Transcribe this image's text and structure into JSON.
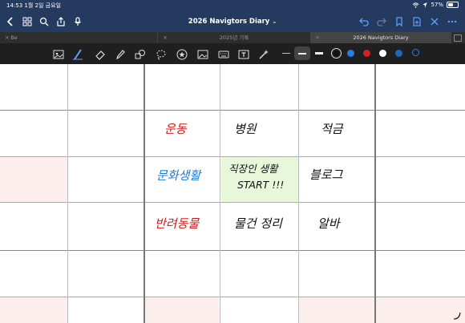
{
  "status_bar": {
    "time": "14:53",
    "date": "1월 2일 금요일",
    "battery": "57%",
    "battery_level": 0.57
  },
  "header": {
    "title": "2026 Navigtors Diary"
  },
  "tabs": [
    {
      "label": "Be",
      "active": false
    },
    {
      "label": "2025년 기록",
      "active": false
    },
    {
      "label": "2026 Navigtors Diary",
      "active": true
    }
  ],
  "toolbar": {
    "tools": [
      "image-icon",
      "pen-icon",
      "eraser-icon",
      "highlighter-icon",
      "shapes-icon",
      "lasso-icon",
      "star-icon",
      "photo-icon",
      "keyboard-icon",
      "text-box-icon",
      "laser-icon"
    ],
    "colors": [
      "#111111",
      "#2a7de1",
      "#d42222",
      "#ffffff",
      "#1f66b8"
    ]
  },
  "grid": {
    "row1": {
      "col1": "",
      "col2": "",
      "col3": "",
      "col4": "",
      "col5": "",
      "col6": ""
    },
    "row2": {
      "c3": "운동",
      "c4": "병원",
      "c5": "적금"
    },
    "row3": {
      "c3": "문화생활",
      "c4_line1": "직장인 생활",
      "c4_line2": "START !!!",
      "c5": "블로그"
    },
    "row4": {
      "c3": "반려동물",
      "c4": "물건 정리",
      "c5": "알바"
    }
  },
  "colors": {
    "red_ink": "#d31c1c",
    "blue_ink": "#1f7ad6",
    "green_highlight": "#e8f7d9",
    "pink_cell": "#fdeeee"
  }
}
